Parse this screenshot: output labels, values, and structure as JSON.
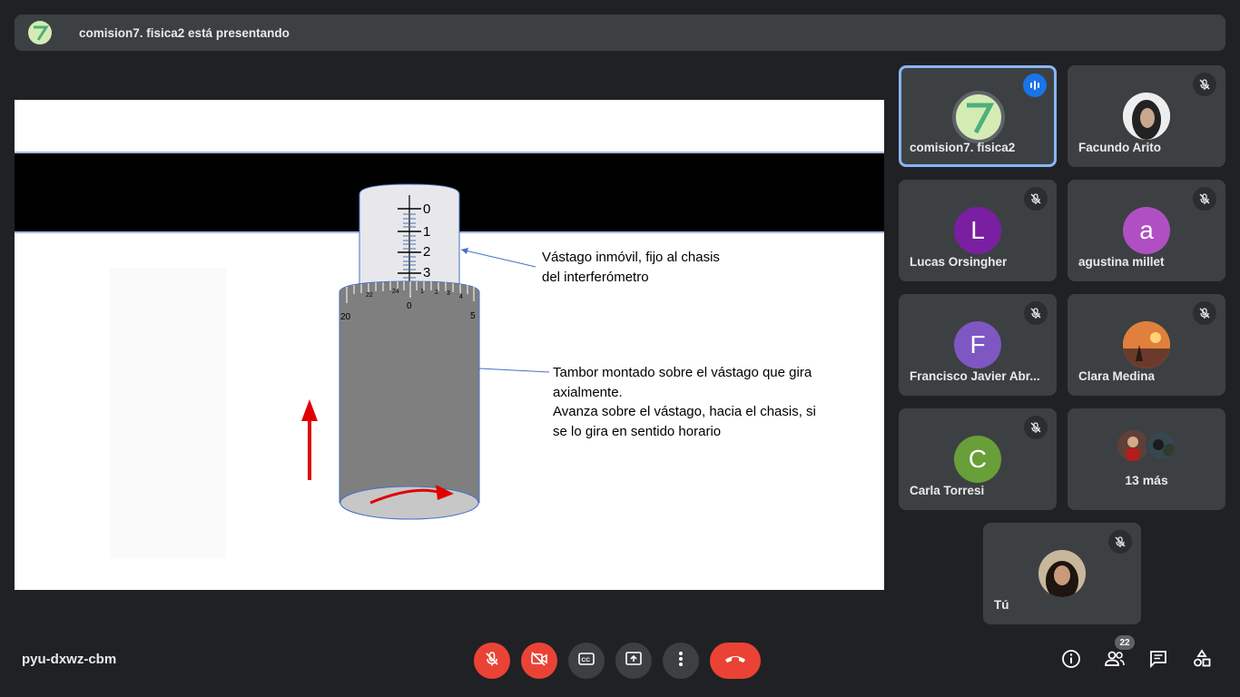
{
  "banner": {
    "text": "comision7. fisica2 está presentando"
  },
  "slide": {
    "scale_marks": [
      "0",
      "1",
      "2",
      "3"
    ],
    "drum_marks": [
      "20",
      "22",
      "24",
      "0",
      "1",
      "2",
      "3",
      "4",
      "5"
    ],
    "annotation_1": [
      "Vástago inmóvil, fijo al chasis",
      "del interferómetro"
    ],
    "annotation_2": [
      "Tambor montado sobre el vástago que gira",
      "axialmente.",
      "Avanza sobre el vástago, hacia el chasis, si",
      "se lo gira en sentido horario"
    ]
  },
  "participants": [
    {
      "name": "comision7. fisica2",
      "avatar_letter": "",
      "avatar_color": "#d4ecb4",
      "speaking": true
    },
    {
      "name": "Facundo Arito",
      "avatar_letter": "",
      "avatar_color": "#ffffff",
      "speaking": false
    },
    {
      "name": "Lucas Orsingher",
      "avatar_letter": "L",
      "avatar_color": "#7b1fa2",
      "speaking": false
    },
    {
      "name": "agustina millet",
      "avatar_letter": "a",
      "avatar_color": "#b04fc4",
      "speaking": false
    },
    {
      "name": "Francisco Javier Abr...",
      "avatar_letter": "F",
      "avatar_color": "#7e57c2",
      "speaking": false
    },
    {
      "name": "Clara Medina",
      "avatar_letter": "",
      "avatar_color": "#e07a3a",
      "speaking": false
    },
    {
      "name": "Carla Torresi",
      "avatar_letter": "C",
      "avatar_color": "#689f38",
      "speaking": false
    },
    {
      "name": "Tú",
      "avatar_letter": "",
      "avatar_color": "#8d6e63",
      "speaking": false
    }
  ],
  "more": {
    "label": "13 más"
  },
  "meeting": {
    "code": "pyu-dxwz-cbm"
  },
  "people_count": "22",
  "colors": {
    "background": "#202124",
    "tile": "#3c4043",
    "accent_red": "#ea4335",
    "accent_blue": "#8ab4f8"
  }
}
